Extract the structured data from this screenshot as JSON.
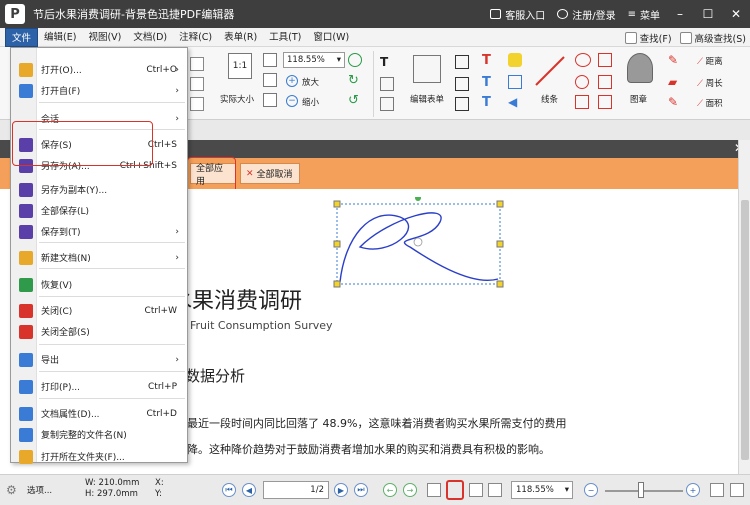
{
  "app": {
    "title": "节后水果消费调研-背景色迅捷PDF编辑器",
    "logo": "P",
    "service_label": "客服入口",
    "login_label": "注册/登录",
    "menu_label": "菜单"
  },
  "menubar": {
    "items": [
      "文件",
      "编辑(E)",
      "视图(V)",
      "文档(D)",
      "注释(C)",
      "表单(R)",
      "工具(T)",
      "窗口(W)"
    ],
    "find_label": "查找(F)",
    "adv_find_label": "高级查找(S)"
  },
  "ribbon": {
    "actual_size": "实际大小",
    "zoom_value": "118.55%",
    "zoom_in": "放大",
    "zoom_out": "缩小",
    "edit_form": "编辑表单",
    "line": "线条",
    "stamp": "图章",
    "distance": "距离",
    "perimeter": "周长",
    "area": "面积"
  },
  "sigbar": {
    "apply_all": "全部应用",
    "cancel_all": "全部取消"
  },
  "document": {
    "title": "水果消费调研",
    "subtitle": "Fruit Consumption Survey",
    "heading": "数据分析",
    "para1": "最近一段时间内同比回落了 48.9%，这意味着消费者购买水果所需支付的费用",
    "para2": "降。这种降价趋势对于鼓励消费者增加水果的购买和消费具有积极的影响。"
  },
  "statusbar": {
    "options": "选项...",
    "width": "W: 210.0mm",
    "height": "H: 297.0mm",
    "x": "X:",
    "y": "Y:",
    "page": "1",
    "page_total": "/2",
    "zoom": "118.55%"
  },
  "filemenu": {
    "items": [
      {
        "label": "打开(O)...",
        "shortcut": "Ctrl+O",
        "arrow": "›",
        "color": "#e8a92a"
      },
      {
        "label": "打开自(F)",
        "shortcut": "",
        "arrow": "›",
        "color": "#3a7bd5"
      },
      {
        "label": "会话",
        "shortcut": "",
        "arrow": "›",
        "color": ""
      },
      {
        "label": "保存(S)",
        "shortcut": "Ctrl+S",
        "arrow": "",
        "color": "#5a3fa8"
      },
      {
        "label": "另存为(A)...",
        "shortcut": "Ctrl+Shift+S",
        "arrow": "",
        "color": "#5a3fa8"
      },
      {
        "label": "另存为副本(Y)...",
        "shortcut": "",
        "arrow": "",
        "color": "#5a3fa8"
      },
      {
        "label": "全部保存(L)",
        "shortcut": "",
        "arrow": "",
        "color": "#5a3fa8"
      },
      {
        "label": "保存到(T)",
        "shortcut": "",
        "arrow": "›",
        "color": "#5a3fa8"
      },
      {
        "label": "新建文档(N)",
        "shortcut": "",
        "arrow": "›",
        "color": "#e8a92a"
      },
      {
        "label": "恢复(V)",
        "shortcut": "",
        "arrow": "",
        "color": "#2e9a4a"
      },
      {
        "label": "关闭(C)",
        "shortcut": "Ctrl+W",
        "arrow": "",
        "color": "#d9342b"
      },
      {
        "label": "关闭全部(S)",
        "shortcut": "",
        "arrow": "",
        "color": "#d9342b"
      },
      {
        "label": "导出",
        "shortcut": "",
        "arrow": "›",
        "color": "#3a7bd5"
      },
      {
        "label": "打印(P)...",
        "shortcut": "Ctrl+P",
        "arrow": "",
        "color": "#3a7bd5"
      },
      {
        "label": "文档属性(D)...",
        "shortcut": "Ctrl+D",
        "arrow": "",
        "color": "#3a7bd5"
      },
      {
        "label": "复制完整的文件名(N)",
        "shortcut": "",
        "arrow": "",
        "color": "#3a7bd5"
      },
      {
        "label": "打开所在文件夹(F)...",
        "shortcut": "",
        "arrow": "",
        "color": "#e8a92a"
      }
    ]
  }
}
